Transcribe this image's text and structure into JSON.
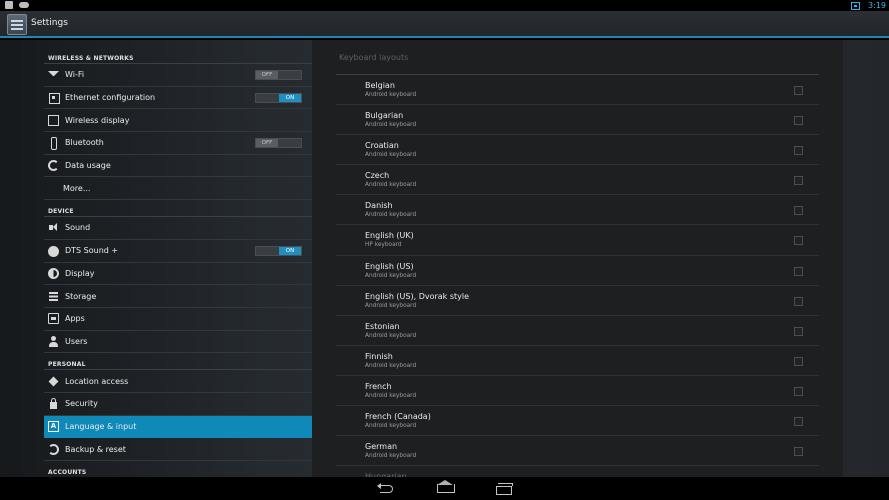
{
  "status_bar": {
    "time": "3:19",
    "icons": [
      "android-notification-icon",
      "gamepad-icon",
      "network-icon"
    ]
  },
  "action_bar": {
    "title": "Settings",
    "icon": "settings-app-icon"
  },
  "nav": {
    "categories": {
      "wireless": "WIRELESS & NETWORKS",
      "device": "DEVICE",
      "personal": "PERSONAL",
      "accounts": "ACCOUNTS"
    },
    "items": [
      {
        "label": "Wi-Fi",
        "icon": "wifi-icon",
        "toggle": "OFF"
      },
      {
        "label": "Ethernet configuration",
        "icon": "ethernet-icon",
        "toggle": "ON"
      },
      {
        "label": "Wireless display",
        "icon": "wireless-display-icon"
      },
      {
        "label": "Bluetooth",
        "icon": "bluetooth-icon",
        "toggle": "OFF"
      },
      {
        "label": "Data usage",
        "icon": "data-usage-icon"
      },
      {
        "label": "More..."
      },
      {
        "label": "Sound",
        "icon": "sound-icon"
      },
      {
        "label": "DTS Sound +",
        "icon": "dts-icon",
        "toggle": "ON"
      },
      {
        "label": "Display",
        "icon": "display-icon"
      },
      {
        "label": "Storage",
        "icon": "storage-icon"
      },
      {
        "label": "Apps",
        "icon": "apps-icon"
      },
      {
        "label": "Users",
        "icon": "users-icon"
      },
      {
        "label": "Location access",
        "icon": "location-icon"
      },
      {
        "label": "Security",
        "icon": "lock-icon"
      },
      {
        "label": "Language & input",
        "icon": "language-icon",
        "selected": true
      },
      {
        "label": "Backup & reset",
        "icon": "backup-icon"
      }
    ]
  },
  "detail": {
    "title": "Keyboard layouts",
    "layouts": [
      {
        "name": "Belgian",
        "sub": "Android keyboard"
      },
      {
        "name": "Bulgarian",
        "sub": "Android keyboard"
      },
      {
        "name": "Croatian",
        "sub": "Android keyboard"
      },
      {
        "name": "Czech",
        "sub": "Android keyboard"
      },
      {
        "name": "Danish",
        "sub": "Android keyboard"
      },
      {
        "name": "English (UK)",
        "sub": "HP keyboard"
      },
      {
        "name": "English (US)",
        "sub": "Android keyboard"
      },
      {
        "name": "English (US), Dvorak style",
        "sub": "Android keyboard"
      },
      {
        "name": "Estonian",
        "sub": "Android keyboard"
      },
      {
        "name": "Finnish",
        "sub": "Android keyboard"
      },
      {
        "name": "French",
        "sub": "Android keyboard"
      },
      {
        "name": "French (Canada)",
        "sub": "Android keyboard"
      },
      {
        "name": "German",
        "sub": "Android keyboard"
      },
      {
        "name": "Hungarian",
        "sub": ""
      }
    ]
  },
  "nav_bar": {
    "buttons": [
      "back-icon",
      "home-icon",
      "recent-apps-icon"
    ]
  },
  "colors": {
    "accent": "#0f89b8",
    "status_time": "#33b5e5"
  }
}
